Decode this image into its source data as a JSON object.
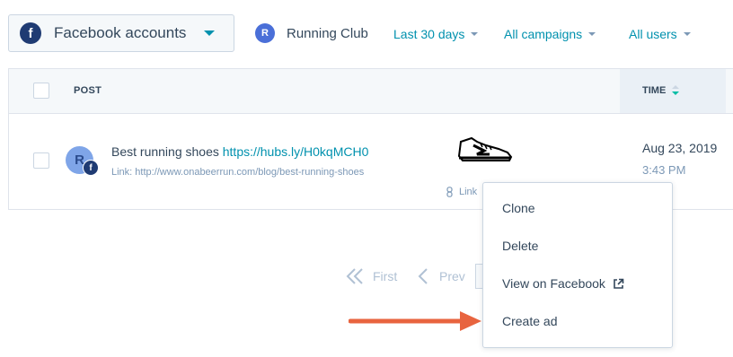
{
  "filters": {
    "account_icon": "facebook-icon",
    "account_icon_letter": "f",
    "account_label": "Facebook accounts",
    "club_avatar_letter": "R",
    "club_label": "Running Club",
    "date_range": "Last 30 days",
    "campaigns": "All campaigns",
    "users": "All users"
  },
  "table": {
    "headers": {
      "post": "POST",
      "time": "TIME"
    },
    "rows": [
      {
        "avatar_letter": "R",
        "network_badge_letter": "f",
        "title": "Best running shoes ",
        "title_url": "https://hubs.ly/H0kqMCH0",
        "link_line": "Link: http://www.onabeerrun.com/blog/best-running-shoes",
        "link_tag": "Link",
        "image_icon": "shoe-icon",
        "date": "Aug 23, 2019",
        "time": "3:43 PM"
      }
    ]
  },
  "pagination": {
    "first": "First",
    "prev": "Prev"
  },
  "row_menu": {
    "items": [
      "Clone",
      "Delete",
      "View on Facebook",
      "Create ad"
    ],
    "external_icon": "external-link-icon"
  },
  "annotation": {
    "arrow_color": "#e8643f"
  },
  "colors": {
    "accent": "#0091ae",
    "text": "#33475b",
    "muted": "#7c98b6",
    "border": "#cbd6e2"
  }
}
